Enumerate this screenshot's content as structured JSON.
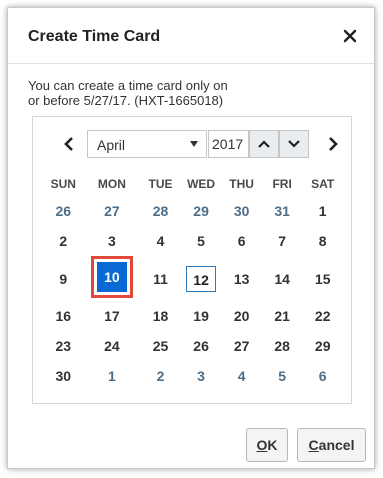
{
  "dialog": {
    "title": "Create Time Card",
    "close_icon": "close-icon",
    "message_line1": "You can create a time card only on",
    "message_line2": "or before 5/27/17. (HXT-1665018)"
  },
  "calendar": {
    "month": "April",
    "year": "2017",
    "weekdays": [
      "SUN",
      "MON",
      "TUE",
      "WED",
      "THU",
      "FRI",
      "SAT"
    ],
    "weeks": [
      [
        {
          "d": "26",
          "o": true
        },
        {
          "d": "27",
          "o": true
        },
        {
          "d": "28",
          "o": true
        },
        {
          "d": "29",
          "o": true
        },
        {
          "d": "30",
          "o": true
        },
        {
          "d": "31",
          "o": true
        },
        {
          "d": "1"
        }
      ],
      [
        {
          "d": "2"
        },
        {
          "d": "3"
        },
        {
          "d": "4"
        },
        {
          "d": "5"
        },
        {
          "d": "6"
        },
        {
          "d": "7"
        },
        {
          "d": "8"
        }
      ],
      [
        {
          "d": "9"
        },
        {
          "d": "10",
          "sel": true
        },
        {
          "d": "11"
        },
        {
          "d": "12",
          "today": true
        },
        {
          "d": "13"
        },
        {
          "d": "14"
        },
        {
          "d": "15"
        }
      ],
      [
        {
          "d": "16"
        },
        {
          "d": "17"
        },
        {
          "d": "18"
        },
        {
          "d": "19"
        },
        {
          "d": "20"
        },
        {
          "d": "21"
        },
        {
          "d": "22"
        }
      ],
      [
        {
          "d": "23"
        },
        {
          "d": "24"
        },
        {
          "d": "25"
        },
        {
          "d": "26"
        },
        {
          "d": "27"
        },
        {
          "d": "28"
        },
        {
          "d": "29"
        }
      ],
      [
        {
          "d": "30"
        },
        {
          "d": "1",
          "o": true
        },
        {
          "d": "2",
          "o": true
        },
        {
          "d": "3",
          "o": true
        },
        {
          "d": "4",
          "o": true
        },
        {
          "d": "5",
          "o": true
        },
        {
          "d": "6",
          "o": true
        }
      ]
    ],
    "selected_day": "10",
    "today_day": "12"
  },
  "buttons": {
    "ok_mnemonic": "O",
    "ok_rest": "K",
    "cancel_mnemonic": "C",
    "cancel_rest": "ancel"
  },
  "colors": {
    "selected_fill": "#0a6ad4",
    "selected_outline": "#e14a3b",
    "today_border": "#2f7bbf",
    "other_month_text": "#4d6e88"
  }
}
